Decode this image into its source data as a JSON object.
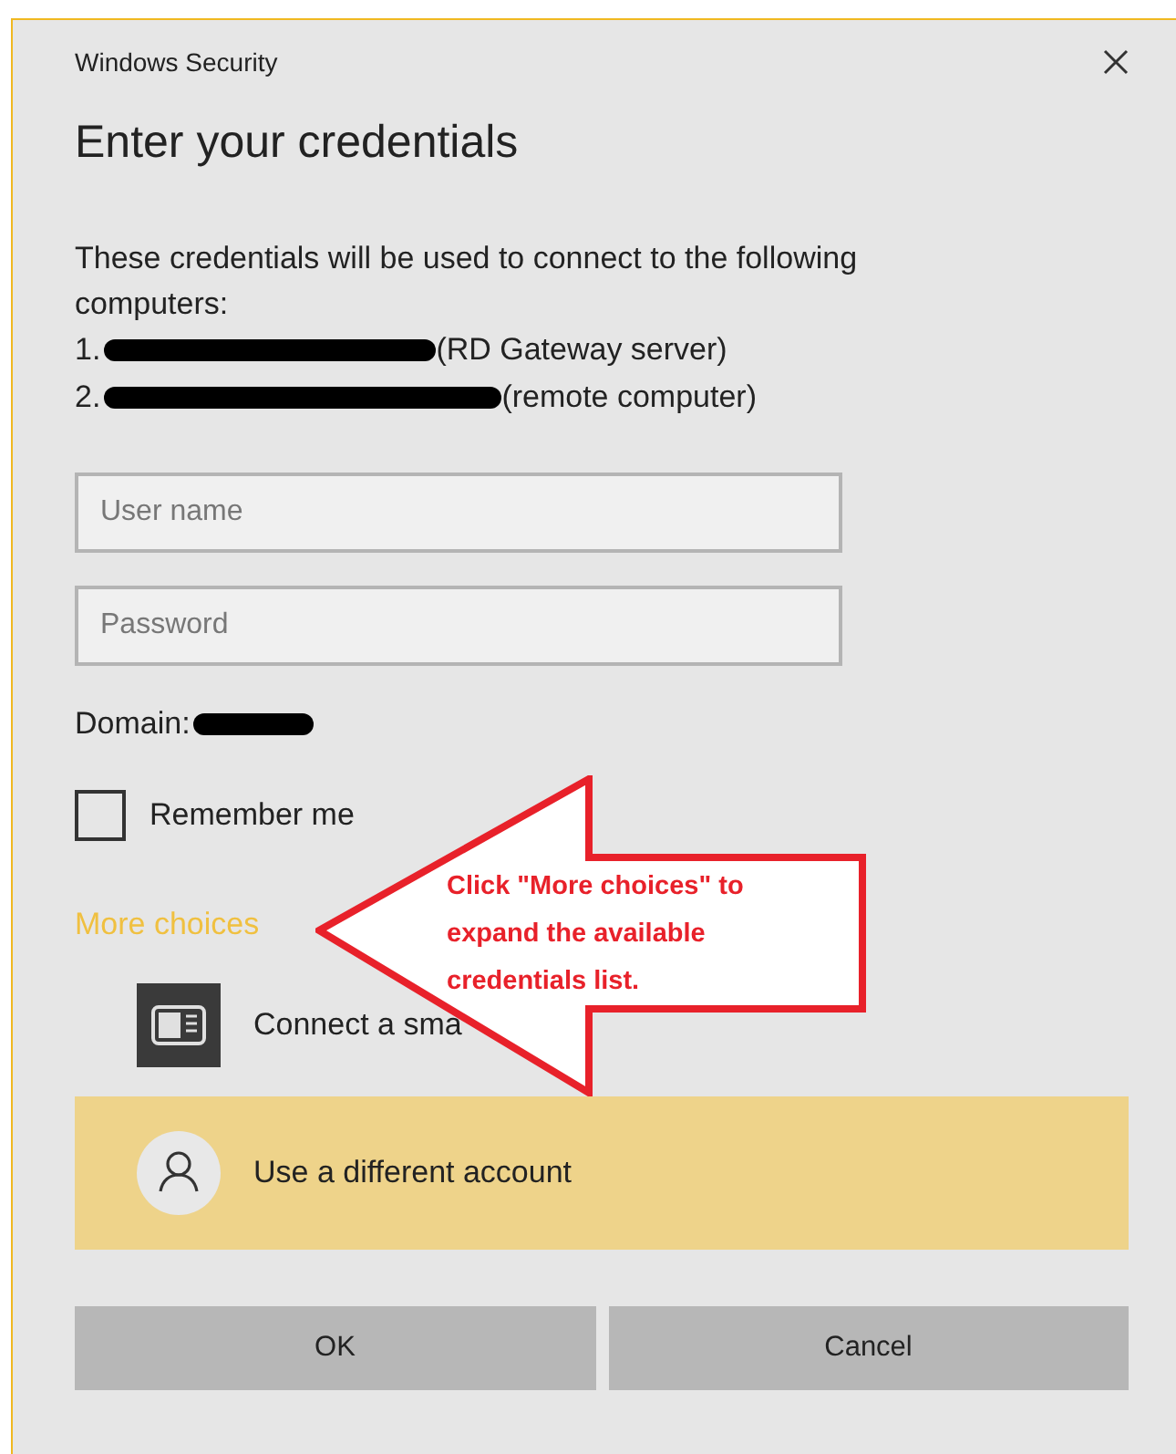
{
  "window": {
    "title": "Windows Security"
  },
  "heading": "Enter your credentials",
  "intro": "These credentials will be used to connect to the following computers:",
  "computers": [
    {
      "number": "1.",
      "role": "(RD Gateway server)"
    },
    {
      "number": "2.",
      "role": "(remote computer)"
    }
  ],
  "fields": [
    {
      "placeholder": "User name"
    },
    {
      "placeholder": "Password"
    }
  ],
  "domain": {
    "label": "Domain:"
  },
  "remember": {
    "label": "Remember me",
    "checked": false
  },
  "more_choices": "More choices",
  "options": [
    {
      "kind": "smartcard",
      "label": "Connect a sma",
      "selected": false
    },
    {
      "kind": "account",
      "label": "Use a different account",
      "selected": true
    }
  ],
  "buttons": [
    "OK",
    "Cancel"
  ],
  "callout": {
    "text": "Click \"More choices\" to expand the available credentials list."
  }
}
